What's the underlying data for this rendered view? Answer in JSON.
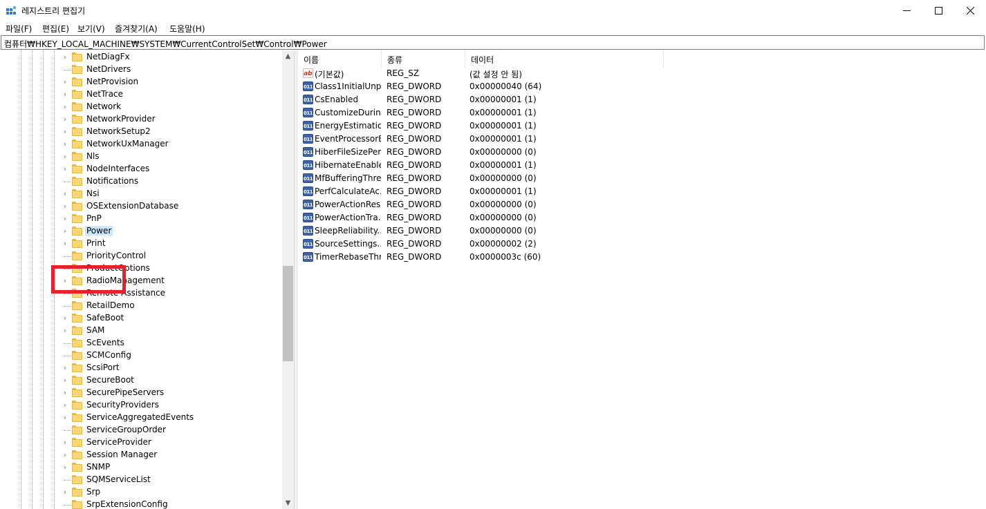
{
  "window": {
    "title": "레지스트리 편집기",
    "app_icon": "regedit-icon"
  },
  "window_controls": {
    "minimize": "—",
    "maximize": "☐",
    "close": "✕"
  },
  "menu": [
    "파일(F)",
    "편집(E)",
    "보기(V)",
    "즐겨찾기(A)",
    "도움말(H)"
  ],
  "address": "컴퓨터₩HKEY_LOCAL_MACHINE₩SYSTEM₩CurrentControlSet₩Control₩Power",
  "tree": {
    "items": [
      {
        "label": "NetDiagFx",
        "expandable": true
      },
      {
        "label": "NetDrivers",
        "expandable": false
      },
      {
        "label": "NetProvision",
        "expandable": true
      },
      {
        "label": "NetTrace",
        "expandable": true
      },
      {
        "label": "Network",
        "expandable": true
      },
      {
        "label": "NetworkProvider",
        "expandable": true
      },
      {
        "label": "NetworkSetup2",
        "expandable": true
      },
      {
        "label": "NetworkUxManager",
        "expandable": true
      },
      {
        "label": "Nls",
        "expandable": true
      },
      {
        "label": "NodeInterfaces",
        "expandable": true
      },
      {
        "label": "Notifications",
        "expandable": false
      },
      {
        "label": "Nsi",
        "expandable": true
      },
      {
        "label": "OSExtensionDatabase",
        "expandable": true
      },
      {
        "label": "PnP",
        "expandable": true
      },
      {
        "label": "Power",
        "expandable": true,
        "selected": true
      },
      {
        "label": "Print",
        "expandable": true
      },
      {
        "label": "PriorityControl",
        "expandable": false
      },
      {
        "label": "ProductOptions",
        "expandable": false
      },
      {
        "label": "RadioManagement",
        "expandable": true
      },
      {
        "label": "Remote Assistance",
        "expandable": false
      },
      {
        "label": "RetailDemo",
        "expandable": false
      },
      {
        "label": "SafeBoot",
        "expandable": true
      },
      {
        "label": "SAM",
        "expandable": true
      },
      {
        "label": "ScEvents",
        "expandable": false
      },
      {
        "label": "SCMConfig",
        "expandable": false
      },
      {
        "label": "ScsiPort",
        "expandable": true
      },
      {
        "label": "SecureBoot",
        "expandable": true
      },
      {
        "label": "SecurePipeServers",
        "expandable": true
      },
      {
        "label": "SecurityProviders",
        "expandable": true
      },
      {
        "label": "ServiceAggregatedEvents",
        "expandable": true
      },
      {
        "label": "ServiceGroupOrder",
        "expandable": false
      },
      {
        "label": "ServiceProvider",
        "expandable": true
      },
      {
        "label": "Session Manager",
        "expandable": true
      },
      {
        "label": "SNMP",
        "expandable": true
      },
      {
        "label": "SQMServiceList",
        "expandable": false
      },
      {
        "label": "Srp",
        "expandable": true
      },
      {
        "label": "SrpExtensionConfig",
        "expandable": false
      }
    ]
  },
  "list": {
    "columns": [
      "이름",
      "종류",
      "데이터"
    ],
    "rows": [
      {
        "icon": "string-value-icon",
        "glyph": "ab",
        "name": "(기본값)",
        "type": "REG_SZ",
        "data": "(값 설정 안 됨)"
      },
      {
        "icon": "dword-value-icon",
        "glyph": "011\n110",
        "name": "Class1InitialUnp...",
        "type": "REG_DWORD",
        "data": "0x00000040 (64)"
      },
      {
        "icon": "dword-value-icon",
        "glyph": "011\n110",
        "name": "CsEnabled",
        "type": "REG_DWORD",
        "data": "0x00000001 (1)"
      },
      {
        "icon": "dword-value-icon",
        "glyph": "011\n110",
        "name": "CustomizeDurin...",
        "type": "REG_DWORD",
        "data": "0x00000001 (1)"
      },
      {
        "icon": "dword-value-icon",
        "glyph": "011\n110",
        "name": "EnergyEstimatio...",
        "type": "REG_DWORD",
        "data": "0x00000001 (1)"
      },
      {
        "icon": "dword-value-icon",
        "glyph": "011\n110",
        "name": "EventProcessorE...",
        "type": "REG_DWORD",
        "data": "0x00000001 (1)"
      },
      {
        "icon": "dword-value-icon",
        "glyph": "011\n110",
        "name": "HiberFileSizePer...",
        "type": "REG_DWORD",
        "data": "0x00000000 (0)"
      },
      {
        "icon": "dword-value-icon",
        "glyph": "011\n110",
        "name": "HibernateEnable...",
        "type": "REG_DWORD",
        "data": "0x00000001 (1)"
      },
      {
        "icon": "dword-value-icon",
        "glyph": "011\n110",
        "name": "MfBufferingThre...",
        "type": "REG_DWORD",
        "data": "0x00000000 (0)"
      },
      {
        "icon": "dword-value-icon",
        "glyph": "011\n110",
        "name": "PerfCalculateAc...",
        "type": "REG_DWORD",
        "data": "0x00000001 (1)"
      },
      {
        "icon": "dword-value-icon",
        "glyph": "011\n110",
        "name": "PowerActionRes...",
        "type": "REG_DWORD",
        "data": "0x00000000 (0)"
      },
      {
        "icon": "dword-value-icon",
        "glyph": "011\n110",
        "name": "PowerActionTra...",
        "type": "REG_DWORD",
        "data": "0x00000000 (0)"
      },
      {
        "icon": "dword-value-icon",
        "glyph": "011\n110",
        "name": "SleepReliability...",
        "type": "REG_DWORD",
        "data": "0x00000000 (0)"
      },
      {
        "icon": "dword-value-icon",
        "glyph": "011\n110",
        "name": "SourceSettings...",
        "type": "REG_DWORD",
        "data": "0x00000002 (2)"
      },
      {
        "icon": "dword-value-icon",
        "glyph": "011\n110",
        "name": "TimerRebaseThr...",
        "type": "REG_DWORD",
        "data": "0x0000003c (60)"
      }
    ]
  },
  "annotation": {
    "color": "#e8202a"
  }
}
